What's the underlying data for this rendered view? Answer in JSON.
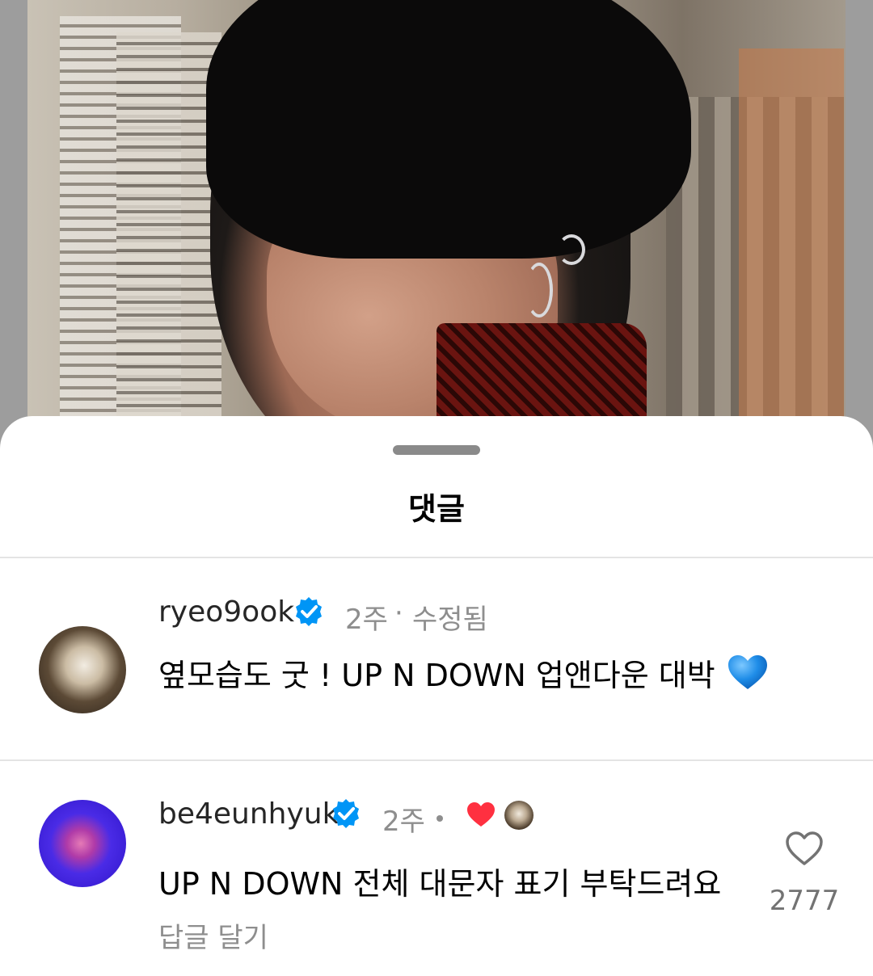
{
  "sheet": {
    "title": "댓글"
  },
  "comments": [
    {
      "username": "ryeo9ook",
      "verified": true,
      "time": "2주",
      "separator": "·",
      "edited": "수정됨",
      "text": "옆모습도 굿 ! UP N DOWN 업앤다운 대박",
      "emoji": "blue-heart"
    },
    {
      "username": "be4eunhyuk",
      "verified": true,
      "time": "2주",
      "creator_liked": true,
      "text": "UP N DOWN 전체 대문자 표기 부탁드려요",
      "reply_label": "답글 달기",
      "like_count": "2777"
    }
  ],
  "colors": {
    "verified_blue": "#0095f6",
    "heart_red": "#ff3040",
    "text_primary": "#000000",
    "text_secondary": "#8e8e8e"
  }
}
